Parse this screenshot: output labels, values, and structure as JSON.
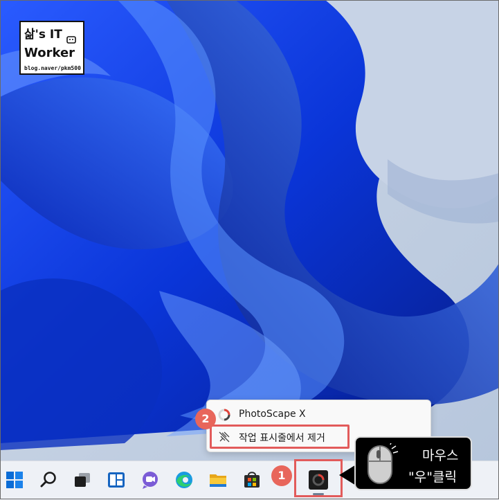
{
  "watermark": {
    "line1": "삶's IT",
    "line2": "Worker",
    "line3": "blog.naver/pkm500"
  },
  "context_menu": {
    "items": [
      {
        "label": "PhotoScape X",
        "icon": "photoscape-icon"
      },
      {
        "label": "작업 표시줄에서 제거",
        "icon": "unpin-icon"
      }
    ]
  },
  "taskbar": {
    "items": [
      "start-icon",
      "search-icon",
      "task-view-icon",
      "widgets-icon",
      "chat-icon",
      "edge-icon",
      "file-explorer-icon",
      "store-icon",
      "photoscape-icon"
    ]
  },
  "badges": {
    "step1": "1",
    "step2": "2"
  },
  "callout": {
    "line1": "마우스",
    "line2": "\"우\"클릭"
  },
  "colors": {
    "highlight": "#e25b5b",
    "badge": "#e8665b"
  }
}
